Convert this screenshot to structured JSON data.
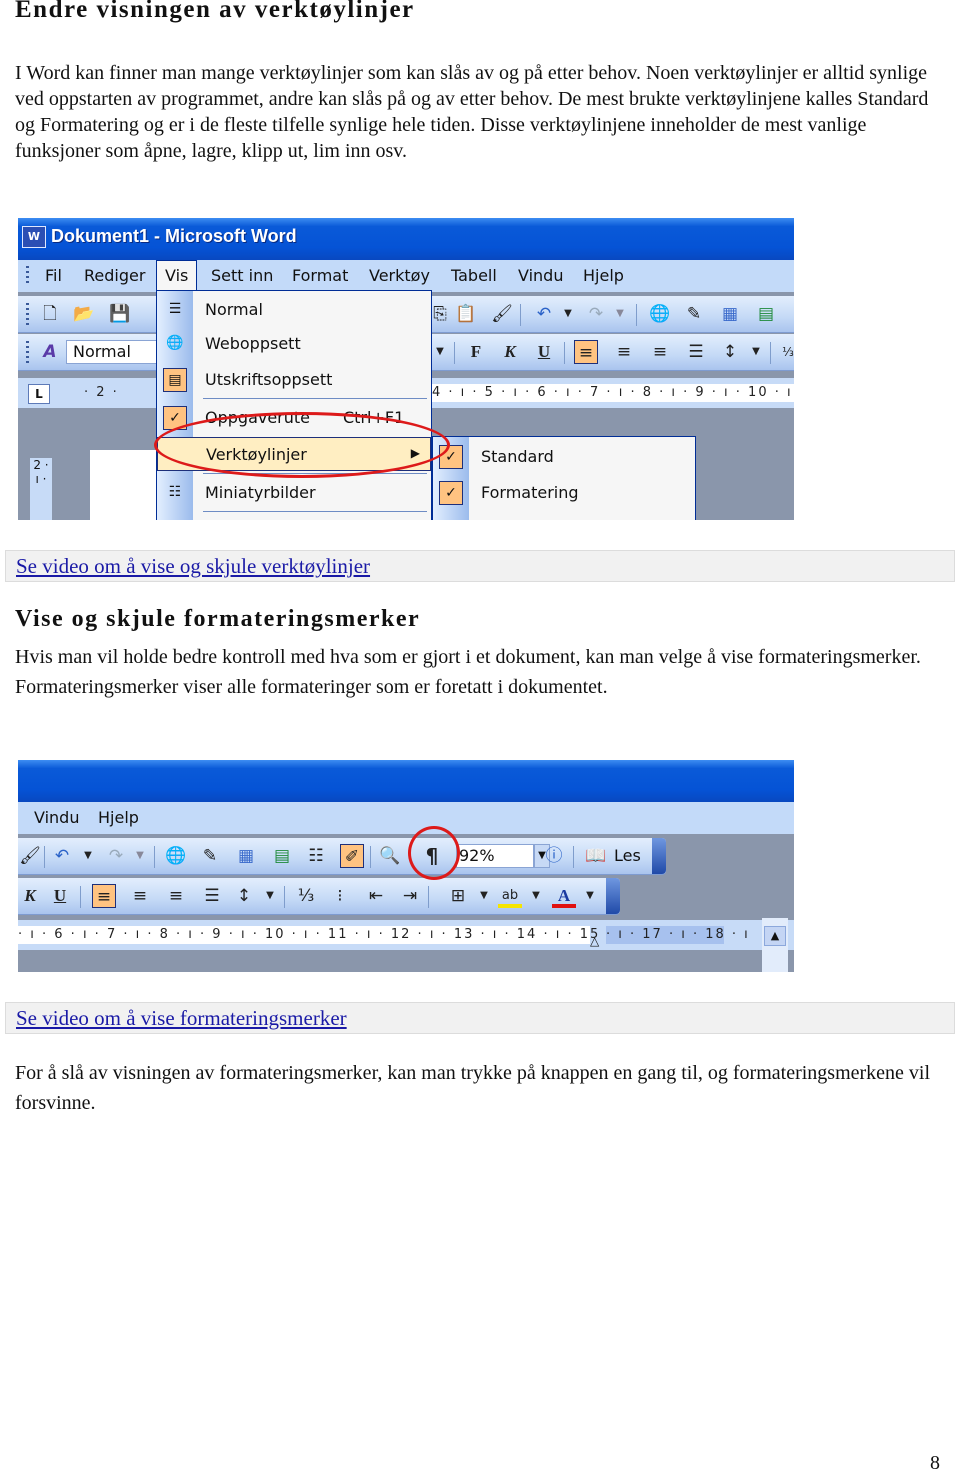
{
  "section1": {
    "title": "Endre visningen av verktøylinjer",
    "paragraph": "I Word kan finner man mange verktøylinjer som kan slås av og på etter behov. Noen verktøylinjer er alltid synlige ved oppstarten av programmet, andre kan slås på og av etter behov. De mest brukte verktøylinjene kalles Standard og Formatering og er i de fleste tilfelle synlige hele tiden. Disse verktøylinjene inneholder de mest vanlige funksjoner som åpne, lagre, klipp ut, lim inn osv.",
    "video_link": "Se video om å vise og skjule verktøylinjer"
  },
  "screenshot1": {
    "window_title": "Dokument1 - Microsoft Word",
    "app_icon": "W",
    "menu": [
      "Fil",
      "Rediger",
      "Vis",
      "Sett inn",
      "Format",
      "Verktøy",
      "Tabell",
      "Vindu",
      "Hjelp"
    ],
    "open_menu": "Vis",
    "style_box": "Normal",
    "ruler_left": "· 2 ·",
    "ruler_right": "4 · ı · 5 · ı · 6 · ı · 7 · ı · 8 · ı · 9 · ı · 10 · ı",
    "vertical_ruler": "2 · ı ·",
    "format_buttons": {
      "bold": "F",
      "italic": "K",
      "underline": "U"
    },
    "vis_menu_items": [
      {
        "label": "Normal",
        "icon": "normal-view-icon",
        "checked": false
      },
      {
        "label": "Weboppsett",
        "icon": "web-layout-icon",
        "checked": false
      },
      {
        "label": "Utskriftsoppsett",
        "icon": "print-layout-icon",
        "checked": true
      },
      {
        "label": "Oppgaverute",
        "shortcut": "Ctrl+F1",
        "checked": true
      },
      {
        "label": "Verktøylinjer",
        "submenu": true,
        "highlighted": true
      },
      {
        "label": "Miniatyrbilder",
        "icon": "thumbnails-icon",
        "checked": false
      }
    ],
    "toolbars_submenu": [
      {
        "label": "Standard",
        "checked": true
      },
      {
        "label": "Formatering",
        "checked": true
      }
    ],
    "highlight_color": "#dd1a1a"
  },
  "section2": {
    "title": "Vise og skjule formateringsmerker",
    "paragraph": "Hvis man vil holde bedre kontroll med hva som er gjort i et dokument, kan man velge å vise formateringsmerker. Formateringsmerker viser alle formateringer som er foretatt i dokumentet.",
    "video_link": "Se video om å vise formateringsmerker"
  },
  "screenshot2": {
    "menu": [
      "Vindu",
      "Hjelp"
    ],
    "zoom_value": "92%",
    "read_button": "Les",
    "pilcrow": "¶",
    "format_buttons": {
      "italic": "K",
      "underline": "U"
    },
    "ruler": "· ı · 6 · ı · 7 · ı · 8 · ı · 9 · ı · 10 · ı · 11 · ı · 12 · ı · 13 · ı · 14 · ı · 15 · ı ·",
    "ruler_tail": "· ı · 17 · ı · 18 · ı",
    "highlight_color": "#dd1a1a"
  },
  "section3": {
    "paragraph": "For å slå av visningen av formateringsmerker, kan man trykke på knappen en gang til, og formateringsmerkene vil forsvinne."
  },
  "page_number": "8",
  "colors": {
    "link": "#1a1aa6",
    "xp_blue": "#0553d6",
    "menu_highlight": "#ffeec2",
    "check_bg": "#ffc381"
  }
}
